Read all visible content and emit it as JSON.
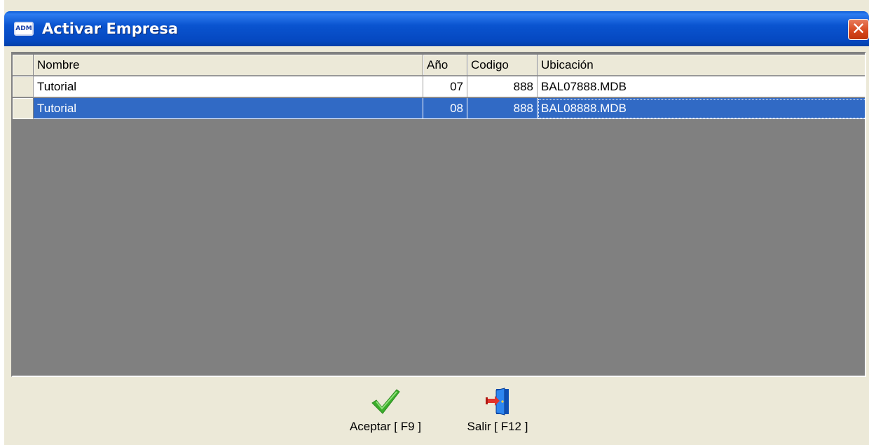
{
  "window": {
    "title": "Activar Empresa",
    "app_icon_text": "ADM",
    "close_glyph": "✕"
  },
  "grid": {
    "columns": [
      "Nombre",
      "Año",
      "Codigo",
      "Ubicación"
    ],
    "rows": [
      {
        "nombre": "Tutorial",
        "anio": "07",
        "codigo": "888",
        "ubicacion": "BAL07888.MDB",
        "selected": false
      },
      {
        "nombre": "Tutorial",
        "anio": "08",
        "codigo": "888",
        "ubicacion": "BAL08888.MDB",
        "selected": true
      }
    ]
  },
  "buttons": {
    "aceptar": {
      "label": "Aceptar [ F9 ]",
      "icon": "checkmark-icon",
      "color": "#3cae2c"
    },
    "salir": {
      "label": "Salir [ F12 ]",
      "icon": "exit-door-icon",
      "color": "#1f6fd8"
    }
  },
  "colors": {
    "titlebar": "#0a54d0",
    "selection": "#316ac5",
    "grid_background": "#808080",
    "close_button": "#d6461c"
  }
}
